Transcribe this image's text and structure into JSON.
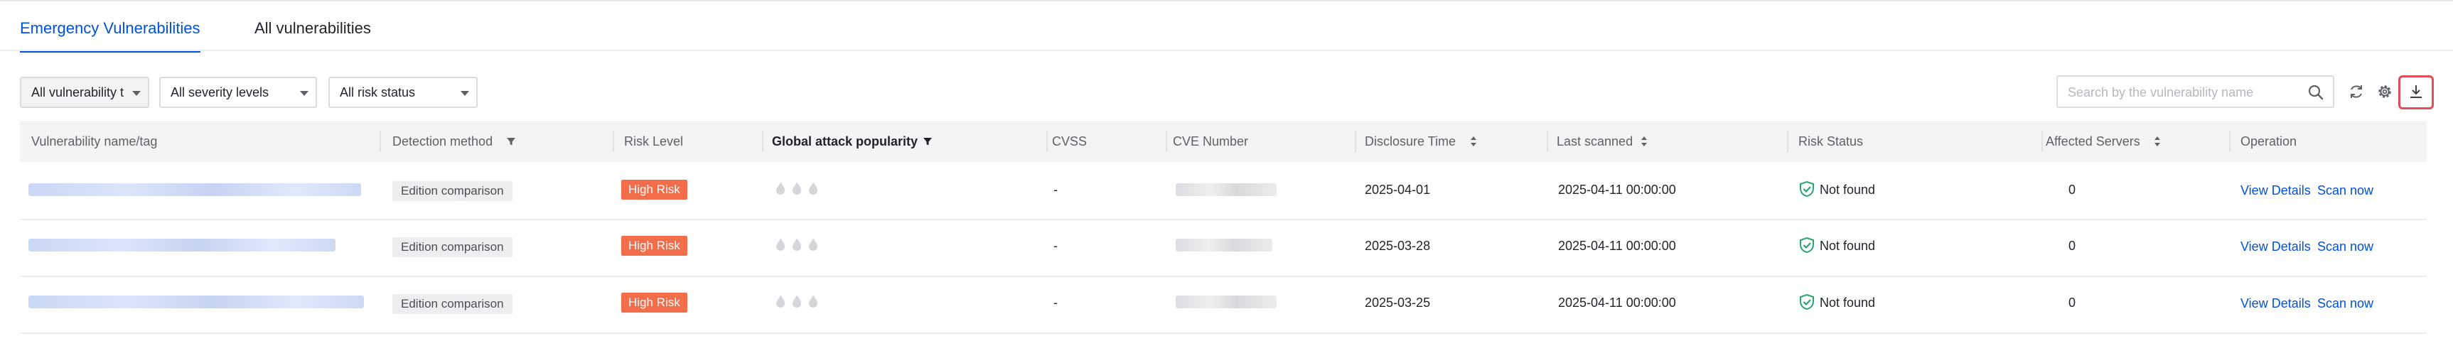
{
  "tabs": [
    {
      "label": "Emergency Vulnerabilities",
      "active": true
    },
    {
      "label": "All vulnerabilities",
      "active": false
    }
  ],
  "filters": {
    "vuln_type": "All vulnerability t",
    "severity": "All severity levels",
    "risk_status": "All risk status"
  },
  "search": {
    "placeholder": "Search by the vulnerability name"
  },
  "toolbar_icons": [
    "refresh-icon",
    "settings-icon",
    "download-icon"
  ],
  "table": {
    "columns": [
      {
        "label": "Vulnerability name/tag"
      },
      {
        "label": "Detection method",
        "icon": "filter-icon"
      },
      {
        "label": "Risk Level"
      },
      {
        "label": "Global attack popularity",
        "icon": "filter-icon"
      },
      {
        "label": "CVSS"
      },
      {
        "label": "CVE Number"
      },
      {
        "label": "Disclosure Time",
        "icon": "sort-icon"
      },
      {
        "label": "Last scanned",
        "icon": "sort-icon"
      },
      {
        "label": "Risk Status"
      },
      {
        "label": "Affected Servers",
        "icon": "sort-icon"
      },
      {
        "label": "Operation"
      }
    ],
    "rows": [
      {
        "detection": "Edition comparison",
        "risk": "High Risk",
        "popularity_level": 0,
        "cvss": "-",
        "disclosure": "2025-04-01",
        "last_scanned": "2025-04-11 00:00:00",
        "status": "Not found",
        "affected": "0",
        "op_details": "View Details",
        "op_scan": "Scan now"
      },
      {
        "detection": "Edition comparison",
        "risk": "High Risk",
        "popularity_level": 0,
        "cvss": "-",
        "disclosure": "2025-03-28",
        "last_scanned": "2025-04-11 00:00:00",
        "status": "Not found",
        "affected": "0",
        "op_details": "View Details",
        "op_scan": "Scan now"
      },
      {
        "detection": "Edition comparison",
        "risk": "High Risk",
        "popularity_level": 0,
        "cvss": "-",
        "disclosure": "2025-03-25",
        "last_scanned": "2025-04-11 00:00:00",
        "status": "Not found",
        "affected": "0",
        "op_details": "View Details",
        "op_scan": "Scan now"
      }
    ]
  },
  "colors": {
    "accent": "#0052d9",
    "high_risk": "#f26e4b",
    "status_ok": "#2ba471",
    "highlight": "#e34d59"
  }
}
